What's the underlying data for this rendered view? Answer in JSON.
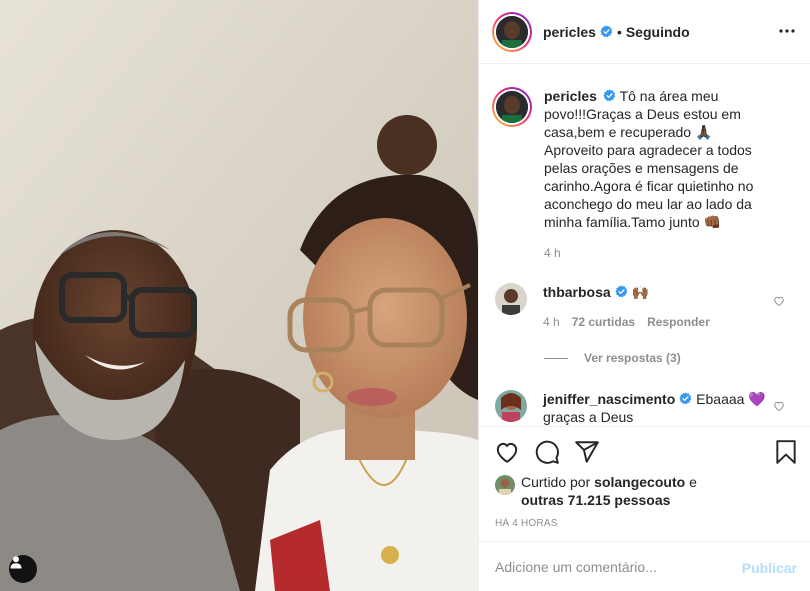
{
  "post": {
    "username": "pericles",
    "follow_status": "Seguindo",
    "separator": "•",
    "icons": {
      "verified": "verified-badge-icon",
      "more": "more-options-icon",
      "user_tag": "user-tag-icon"
    }
  },
  "caption": {
    "username": "pericles",
    "text": "Tô na área meu povo!!!Graças a Deus estou em casa,bem e recuperado 🙏🏿 Aproveito para agradecer a todos pelas orações e mensagens de carinho.Agora é ficar quietinho no aconchego do meu lar ao lado da minha família.Tamo junto 👊🏾",
    "age": "4 h"
  },
  "comments": [
    {
      "username": "thbarbosa",
      "text": "🙌🏾",
      "age": "4 h",
      "likes": "72 curtidas",
      "reply_label": "Responder",
      "view_replies": "Ver respostas (3)"
    },
    {
      "username": "jeniffer_nascimento",
      "text": "Ebaaaa 💜 graças a Deus"
    }
  ],
  "actions": {
    "icons": [
      "heart-icon",
      "comment-icon",
      "share-icon",
      "bookmark-icon"
    ]
  },
  "likes": {
    "prefix": "Curtido por",
    "liker": "solangecouto",
    "conj": "e",
    "others": "outras 71.215 pessoas"
  },
  "timestamp": "Há 4 horas",
  "add_comment": {
    "placeholder": "Adicione um comentário...",
    "publish_label": "Publicar"
  },
  "colors": {
    "verified": "#3897f0",
    "publish_disabled": "#b2dffc",
    "muted_text": "#8e8e8e",
    "border": "#efefef"
  }
}
